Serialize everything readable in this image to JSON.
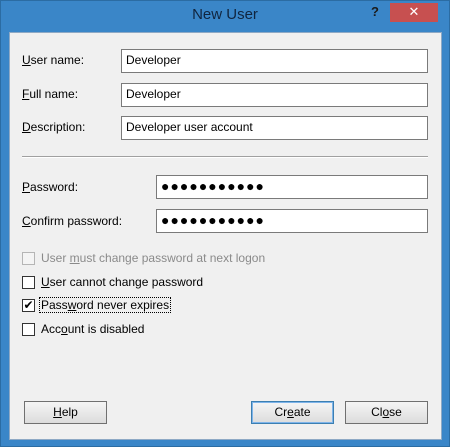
{
  "window": {
    "title": "New User",
    "help_button": "?",
    "close_button": "✕"
  },
  "fields": {
    "user_name": {
      "label_pre": "",
      "label_key": "U",
      "label_post": "ser name:",
      "value": "Developer"
    },
    "full_name": {
      "label_pre": "",
      "label_key": "F",
      "label_post": "ull name:",
      "value": "Developer"
    },
    "description": {
      "label_pre": "",
      "label_key": "D",
      "label_post": "escription:",
      "value": "Developer user account"
    },
    "password": {
      "label_pre": "",
      "label_key": "P",
      "label_post": "assword:",
      "value": "●●●●●●●●●●●"
    },
    "confirm_password": {
      "label_pre": "",
      "label_key": "C",
      "label_post": "onfirm password:",
      "value": "●●●●●●●●●●●"
    }
  },
  "checkboxes": {
    "must_change": {
      "pre": "User ",
      "key": "m",
      "post": "ust change password at next logon",
      "checked": false,
      "enabled": false
    },
    "cannot_change": {
      "pre": "",
      "key": "U",
      "post": "ser cannot change password",
      "checked": false,
      "enabled": true
    },
    "never_expires": {
      "pre": "Pass",
      "key": "w",
      "post": "ord never expires",
      "checked": true,
      "enabled": true,
      "check_glyph": "✔"
    },
    "disabled": {
      "pre": "Acc",
      "key": "o",
      "post": "unt is disabled",
      "checked": false,
      "enabled": true
    }
  },
  "buttons": {
    "help": {
      "pre": "",
      "key": "H",
      "post": "elp"
    },
    "create": {
      "pre": "Cr",
      "key": "e",
      "post": "ate"
    },
    "close": {
      "pre": "Cl",
      "key": "o",
      "post": "se"
    }
  }
}
